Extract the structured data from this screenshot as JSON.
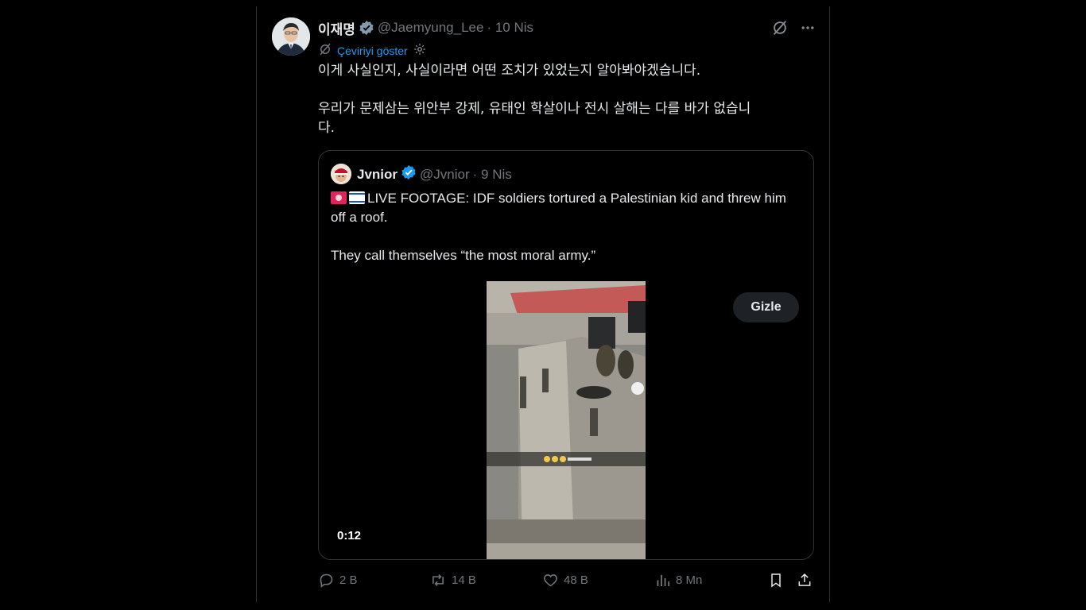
{
  "tweet": {
    "author_name": "이재명",
    "author_handle": "@Jaemyung_Lee",
    "date": "· 10 Nis",
    "translate_label": "Çeviriyi göster",
    "text": "이게 사실인지, 사실이라면 어떤 조치가 있었는지 알아봐야겠습니다.\n\n우리가 문제삼는 위안부 강제, 유태인 학살이나 전시 살해는 다를 바가 없습니\n다."
  },
  "quote": {
    "author_name": "Jvnior",
    "author_handle": "@Jvnior",
    "date": "· 9 Nis",
    "text_line1": "LIVE FOOTAGE: IDF soldiers tortured a Palestinian kid and threw him off a roof.",
    "text_para2": "They call themselves “the most moral army.”",
    "hide_label": "Gizle",
    "timecode": "0:12"
  },
  "actions": {
    "replies": "2 B",
    "reposts": "14 B",
    "likes": "48 B",
    "views": "8 Mn"
  },
  "colors": {
    "background": "#000000",
    "text": "#e7e9ea",
    "muted": "#71767b",
    "accent": "#1d9bf0",
    "border": "#2f3336"
  },
  "icons": [
    "verified-badge-icon",
    "grok-icon",
    "more-icon",
    "translate-icon",
    "settings-icon",
    "siren-emoji-icon",
    "israel-flag-icon",
    "reply-icon",
    "repost-icon",
    "like-icon",
    "views-icon",
    "bookmark-icon",
    "share-icon"
  ]
}
